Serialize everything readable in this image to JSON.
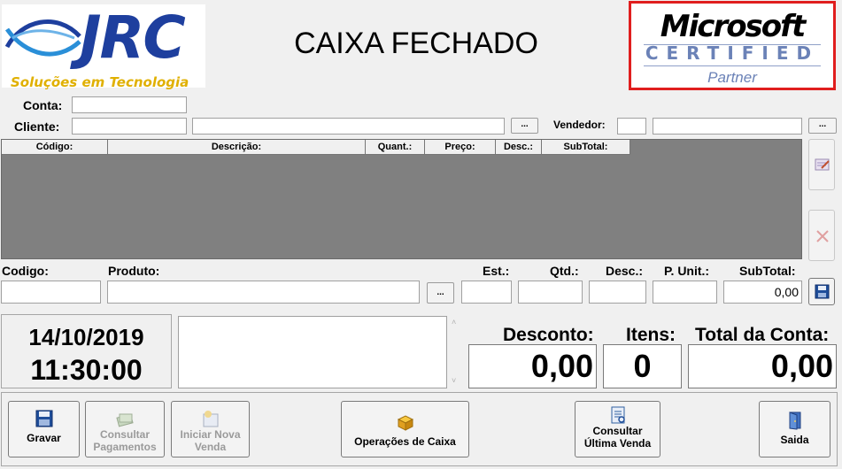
{
  "logo": {
    "brand": "JRC",
    "tagline": "Soluções em Tecnologia"
  },
  "header": {
    "title": "CAIXA FECHADO"
  },
  "badge": {
    "word": "Microsoft",
    "certified": "CERTIFIED",
    "partner": "Partner"
  },
  "form": {
    "conta_label": "Conta:",
    "cliente_label": "Cliente:",
    "vendedor_label": "Vendedor:",
    "dots": "..."
  },
  "grid": {
    "columns": [
      "Código:",
      "Descrição:",
      "Quant.:",
      "Preço:",
      "Desc.:",
      "SubTotal:"
    ]
  },
  "entry": {
    "labels": {
      "codigo": "Codigo:",
      "produto": "Produto:",
      "est": "Est.:",
      "qtd": "Qtd.:",
      "desc": "Desc.:",
      "punit": "P. Unit.:",
      "subtotal": "SubTotal:"
    },
    "subtotal_value": "0,00"
  },
  "clock": {
    "date": "14/10/2019",
    "time": "11:30:00"
  },
  "totals": {
    "desconto_label": "Desconto:",
    "desconto_value": "0,00",
    "itens_label": "Itens:",
    "itens_value": "0",
    "total_label": "Total da Conta:",
    "total_value": "0,00"
  },
  "buttons": {
    "gravar": "Gravar",
    "consultar_pag_1": "Consultar",
    "consultar_pag_2": "Pagamentos",
    "iniciar_1": "Iniciar Nova",
    "iniciar_2": "Venda",
    "operacoes": "Operações de Caixa",
    "ultima_1": "Consultar",
    "ultima_2": "Última Venda",
    "saida": "Saida"
  },
  "colors": {
    "grid_bg": "#808080",
    "logo_blue": "#1e3f9e",
    "badge_red": "#e01e1e"
  }
}
